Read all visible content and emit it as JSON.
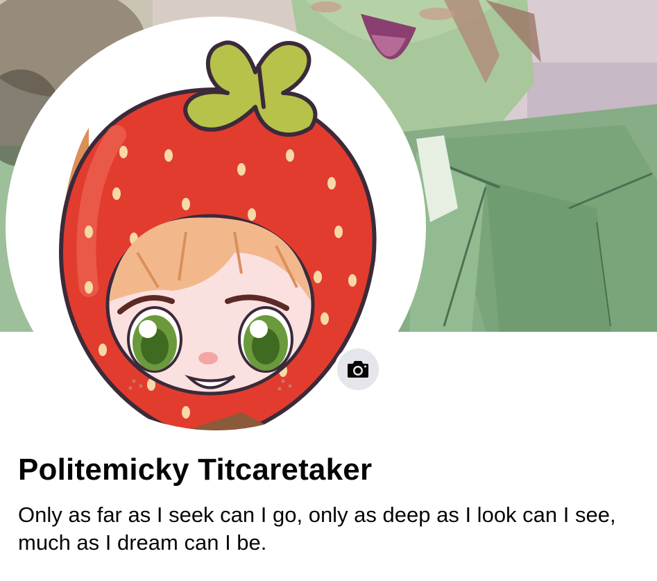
{
  "profile": {
    "name": "Politemicky Titcaretaker",
    "bio_lines": [
      "Only as far as I seek can I go, only as deep as I look can I see,",
      "much as I dream can I be."
    ]
  },
  "icons": {
    "camera": "camera-icon"
  },
  "colors": {
    "text": "#050505",
    "camera_bg": "#e4e6eb",
    "strawberry": "#e03a2f",
    "leaf": "#b7c24a"
  }
}
